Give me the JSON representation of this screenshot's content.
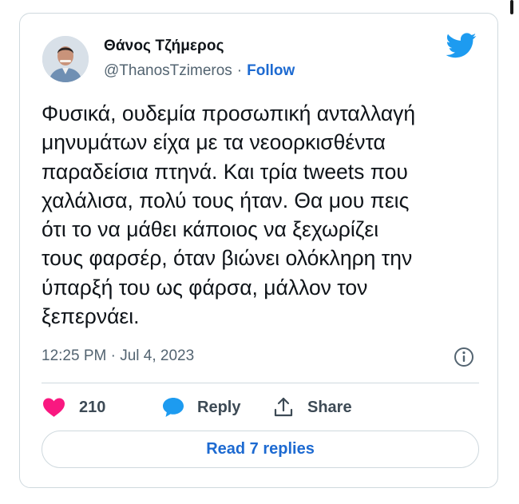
{
  "author": {
    "display_name": "Θάνος Τζήμερος",
    "handle": "@ThanosTzimeros",
    "separator": "·",
    "follow_label": "Follow"
  },
  "tweet": {
    "text": "Φυσικά, ουδεμία προσωπική ανταλλαγή\nμηνυμάτων είχα με τα νεοορκισθέντα\nπαραδείσια πτηνά. Και τρία tweets που\nχαλάλισα, πολύ τους ήταν. Θα μου πεις\nότι το να μάθει κάποιος να ξεχωρίζει\nτους φαρσέρ, όταν βιώνει ολόκληρη την\nύπαρξή του ως φάρσα, μάλλον τον\nξεπερνάει.",
    "timestamp": "12:25 PM · Jul 4, 2023"
  },
  "actions": {
    "like_count": "210",
    "reply_label": "Reply",
    "share_label": "Share"
  },
  "read_replies_label": "Read 7 replies",
  "icons": {
    "brand": "twitter-bird-icon",
    "like": "heart-icon",
    "reply": "speech-bubble-icon",
    "share": "share-upload-icon",
    "info": "info-icon"
  },
  "colors": {
    "twitter_blue": "#1d9bf0",
    "link_blue": "#1d6ad1",
    "like_pink": "#f91880",
    "muted_text": "#536471",
    "border": "#cfd9de"
  }
}
